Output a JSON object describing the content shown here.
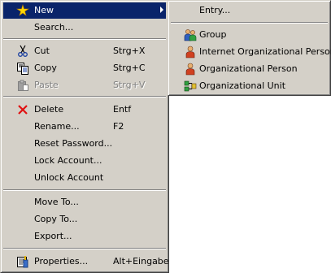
{
  "context_menu": {
    "new": {
      "label": "New"
    },
    "search": {
      "label": "Search..."
    },
    "cut": {
      "label": "Cut",
      "shortcut": "Strg+X"
    },
    "copy": {
      "label": "Copy",
      "shortcut": "Strg+C"
    },
    "paste": {
      "label": "Paste",
      "shortcut": "Strg+V",
      "disabled": true
    },
    "delete": {
      "label": "Delete",
      "shortcut": "Entf"
    },
    "rename": {
      "label": "Rename...",
      "shortcut": "F2"
    },
    "reset_password": {
      "label": "Reset Password..."
    },
    "lock_account": {
      "label": "Lock Account..."
    },
    "unlock_account": {
      "label": "Unlock Account"
    },
    "move_to": {
      "label": "Move To..."
    },
    "copy_to": {
      "label": "Copy To..."
    },
    "export": {
      "label": "Export..."
    },
    "properties": {
      "label": "Properties...",
      "shortcut": "Alt+Eingabe"
    }
  },
  "submenu_new": {
    "entry": {
      "label": "Entry..."
    },
    "group": {
      "label": "Group",
      "icon": "group-icon"
    },
    "internet_org_person": {
      "label": "Internet Organizational Person",
      "icon": "person-icon"
    },
    "org_person": {
      "label": "Organizational Person",
      "icon": "person-icon"
    },
    "org_unit": {
      "label": "Organizational Unit",
      "icon": "organizational-unit-icon"
    }
  },
  "colors": {
    "menu_bg": "#d4d0c8",
    "highlight": "#0a246a",
    "disabled_text": "#808080"
  }
}
